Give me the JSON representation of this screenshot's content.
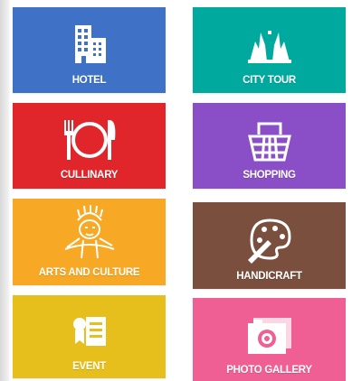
{
  "tiles": [
    {
      "id": "hotel",
      "label": "HOTEL",
      "color": "#3f72c6",
      "icon": "hotel-building-icon"
    },
    {
      "id": "city-tour",
      "label": "CITY TOUR",
      "color": "#00a99d",
      "icon": "temple-gate-icon"
    },
    {
      "id": "cullinary",
      "label": "CULLINARY",
      "color": "#e0262b",
      "icon": "plate-fork-knife-icon"
    },
    {
      "id": "shopping",
      "label": "SHOPPING",
      "color": "#8a4fc6",
      "icon": "shopping-basket-icon"
    },
    {
      "id": "arts-and-culture",
      "label": "ARTS AND CULTURE",
      "color": "#f7a824",
      "icon": "dancer-mask-icon"
    },
    {
      "id": "handicraft",
      "label": "HANDICRAFT",
      "color": "#7a4f3e",
      "icon": "paint-palette-icon"
    },
    {
      "id": "event",
      "label": "EVENT",
      "color": "#e7bf1c",
      "icon": "event-certificate-icon"
    },
    {
      "id": "photo-gallery",
      "label": "PHOTO GALLERY",
      "color": "#ef5f93",
      "icon": "camera-icon"
    }
  ]
}
